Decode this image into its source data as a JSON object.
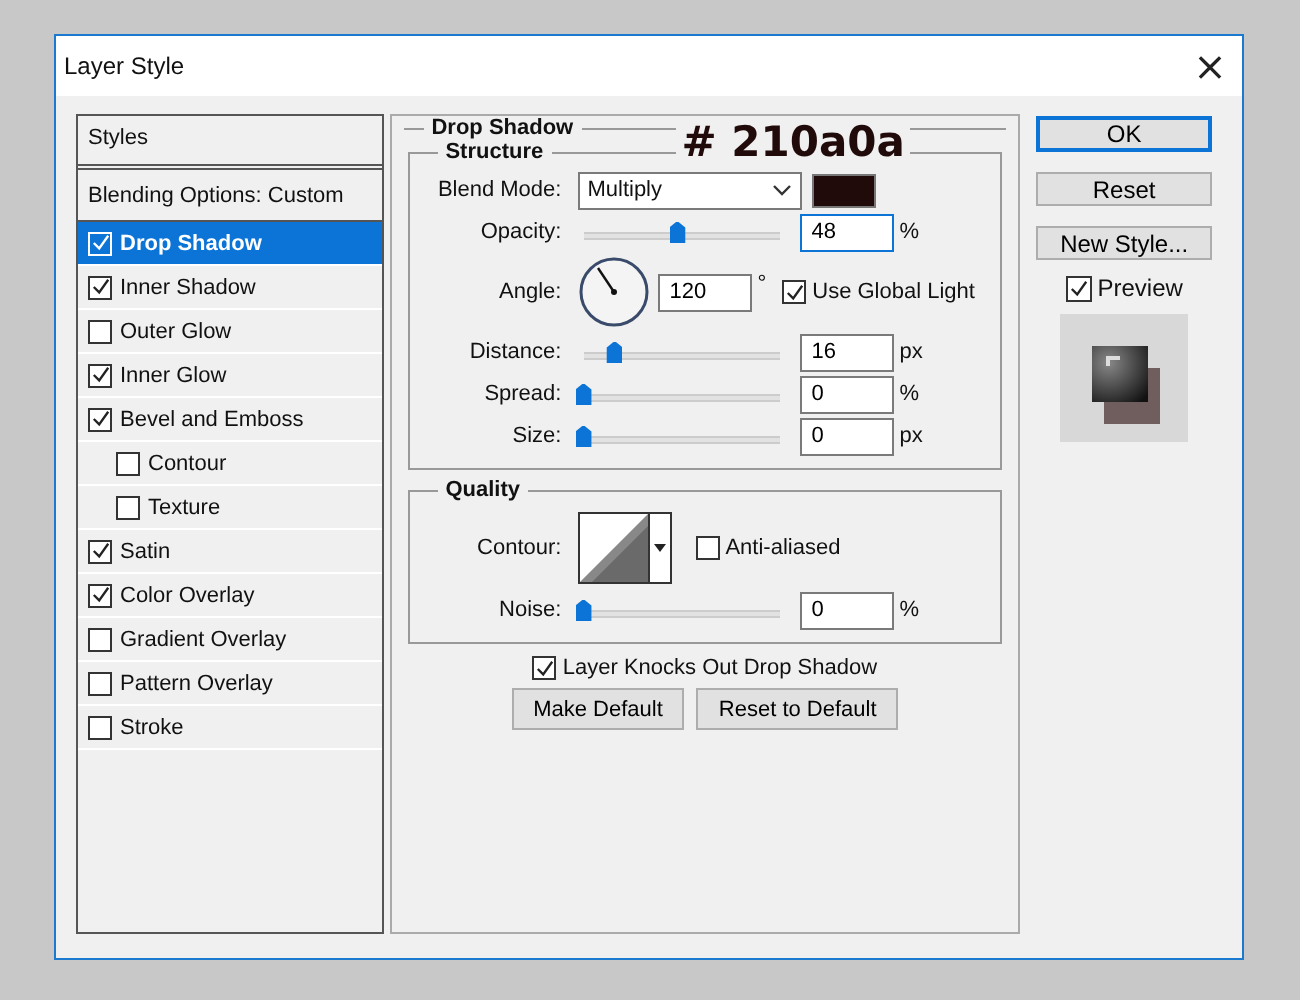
{
  "window": {
    "title": "Layer Style",
    "close": "×"
  },
  "styles_header": "Styles",
  "style_items": [
    {
      "label": "Blending Options: Custom",
      "kind": "plain",
      "selected": false
    },
    {
      "label": "Drop Shadow",
      "kind": "check",
      "checked": true,
      "selected": true
    },
    {
      "label": "Inner Shadow",
      "kind": "check",
      "checked": true,
      "selected": false
    },
    {
      "label": "Outer Glow",
      "kind": "check",
      "checked": false,
      "selected": false
    },
    {
      "label": "Inner Glow",
      "kind": "check",
      "checked": true,
      "selected": false
    },
    {
      "label": "Bevel and Emboss",
      "kind": "check",
      "checked": true,
      "selected": false,
      "children": [
        {
          "label": "Contour",
          "kind": "check",
          "checked": false,
          "selected": false
        },
        {
          "label": "Texture",
          "kind": "check",
          "checked": false,
          "selected": false
        }
      ]
    },
    {
      "label": "Satin",
      "kind": "check",
      "checked": true,
      "selected": false
    },
    {
      "label": "Color Overlay",
      "kind": "check",
      "checked": true,
      "selected": false
    },
    {
      "label": "Gradient Overlay",
      "kind": "check",
      "checked": false,
      "selected": false
    },
    {
      "label": "Pattern Overlay",
      "kind": "check",
      "checked": false,
      "selected": false
    },
    {
      "label": "Stroke",
      "kind": "check",
      "checked": false,
      "selected": false
    }
  ],
  "drop_shadow": {
    "title": "Drop Shadow",
    "annotation": "# 210a0a",
    "structure": {
      "title": "Structure",
      "blend_mode": {
        "label": "Blend Mode:",
        "value": "Multiply",
        "color": "#210a0a"
      },
      "opacity": {
        "label": "Opacity:",
        "level": 0.48,
        "value": "48",
        "unit": "%",
        "focused": true
      },
      "angle": {
        "label": "Angle:",
        "value": "120",
        "unit": "°"
      },
      "use_global_light": {
        "label": "Use Global Light",
        "checked": true
      },
      "rows": [
        {
          "label": "Distance:",
          "level": 0.16,
          "value": "16",
          "unit": "px",
          "focused": false
        },
        {
          "label": "Spread:",
          "level": 0,
          "value": "0",
          "unit": "%",
          "focused": false
        },
        {
          "label": "Size:",
          "level": 0,
          "value": "0",
          "unit": "px",
          "focused": false
        }
      ]
    },
    "quality": {
      "title": "Quality",
      "contour_label": "Contour:",
      "anti_aliased": {
        "label": "Anti-aliased",
        "checked": false
      },
      "noise": {
        "label": "Noise:",
        "level": 0,
        "value": "0",
        "unit": "%",
        "focused": false
      }
    },
    "knockout": {
      "label": "Layer Knocks Out Drop Shadow",
      "checked": true
    },
    "buttons": [
      "Make Default",
      "Reset to Default"
    ]
  },
  "side_buttons": [
    {
      "label": "OK",
      "default": true
    },
    {
      "label": "Reset",
      "default": false
    },
    {
      "label": "New Style...",
      "default": false
    }
  ],
  "preview": {
    "label": "Preview",
    "checked": true
  }
}
